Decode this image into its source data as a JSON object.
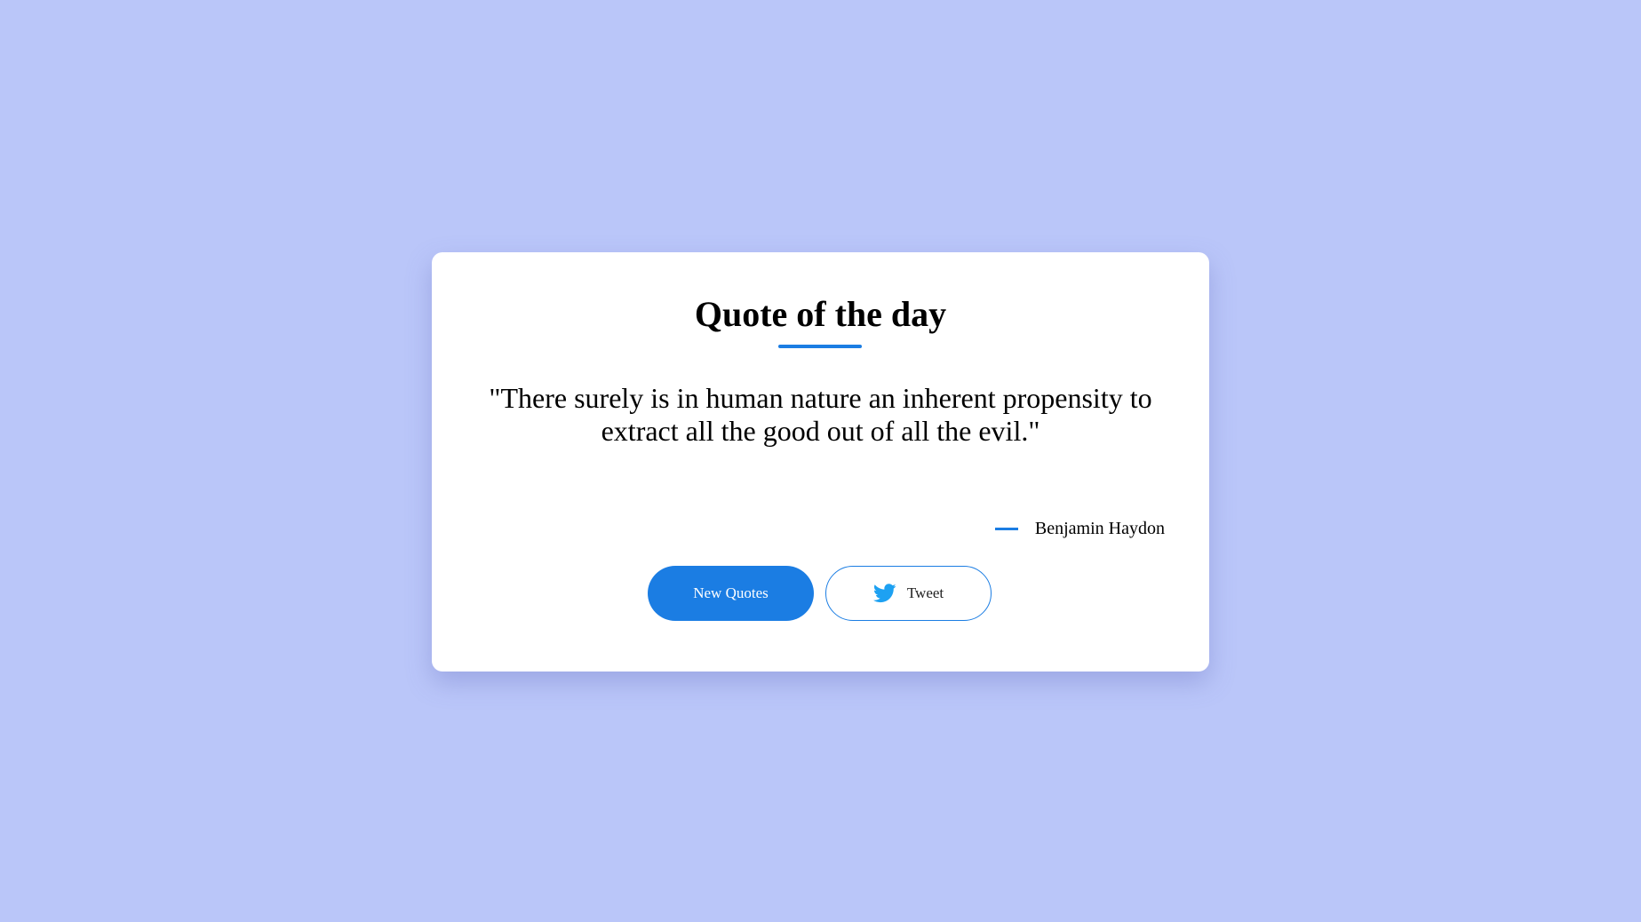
{
  "card": {
    "title": "Quote of the day",
    "quote": "\"There surely is in human nature an inherent propensity to extract all the good out of all the evil.\"",
    "author": "Benjamin Haydon"
  },
  "buttons": {
    "new_quotes_label": "New Quotes",
    "tweet_label": "Tweet",
    "tweet_icon": "twitter-bird-icon"
  },
  "colors": {
    "background": "#bac6f9",
    "accent": "#1b7de3",
    "twitter": "#1da1f2",
    "card": "#ffffff"
  }
}
